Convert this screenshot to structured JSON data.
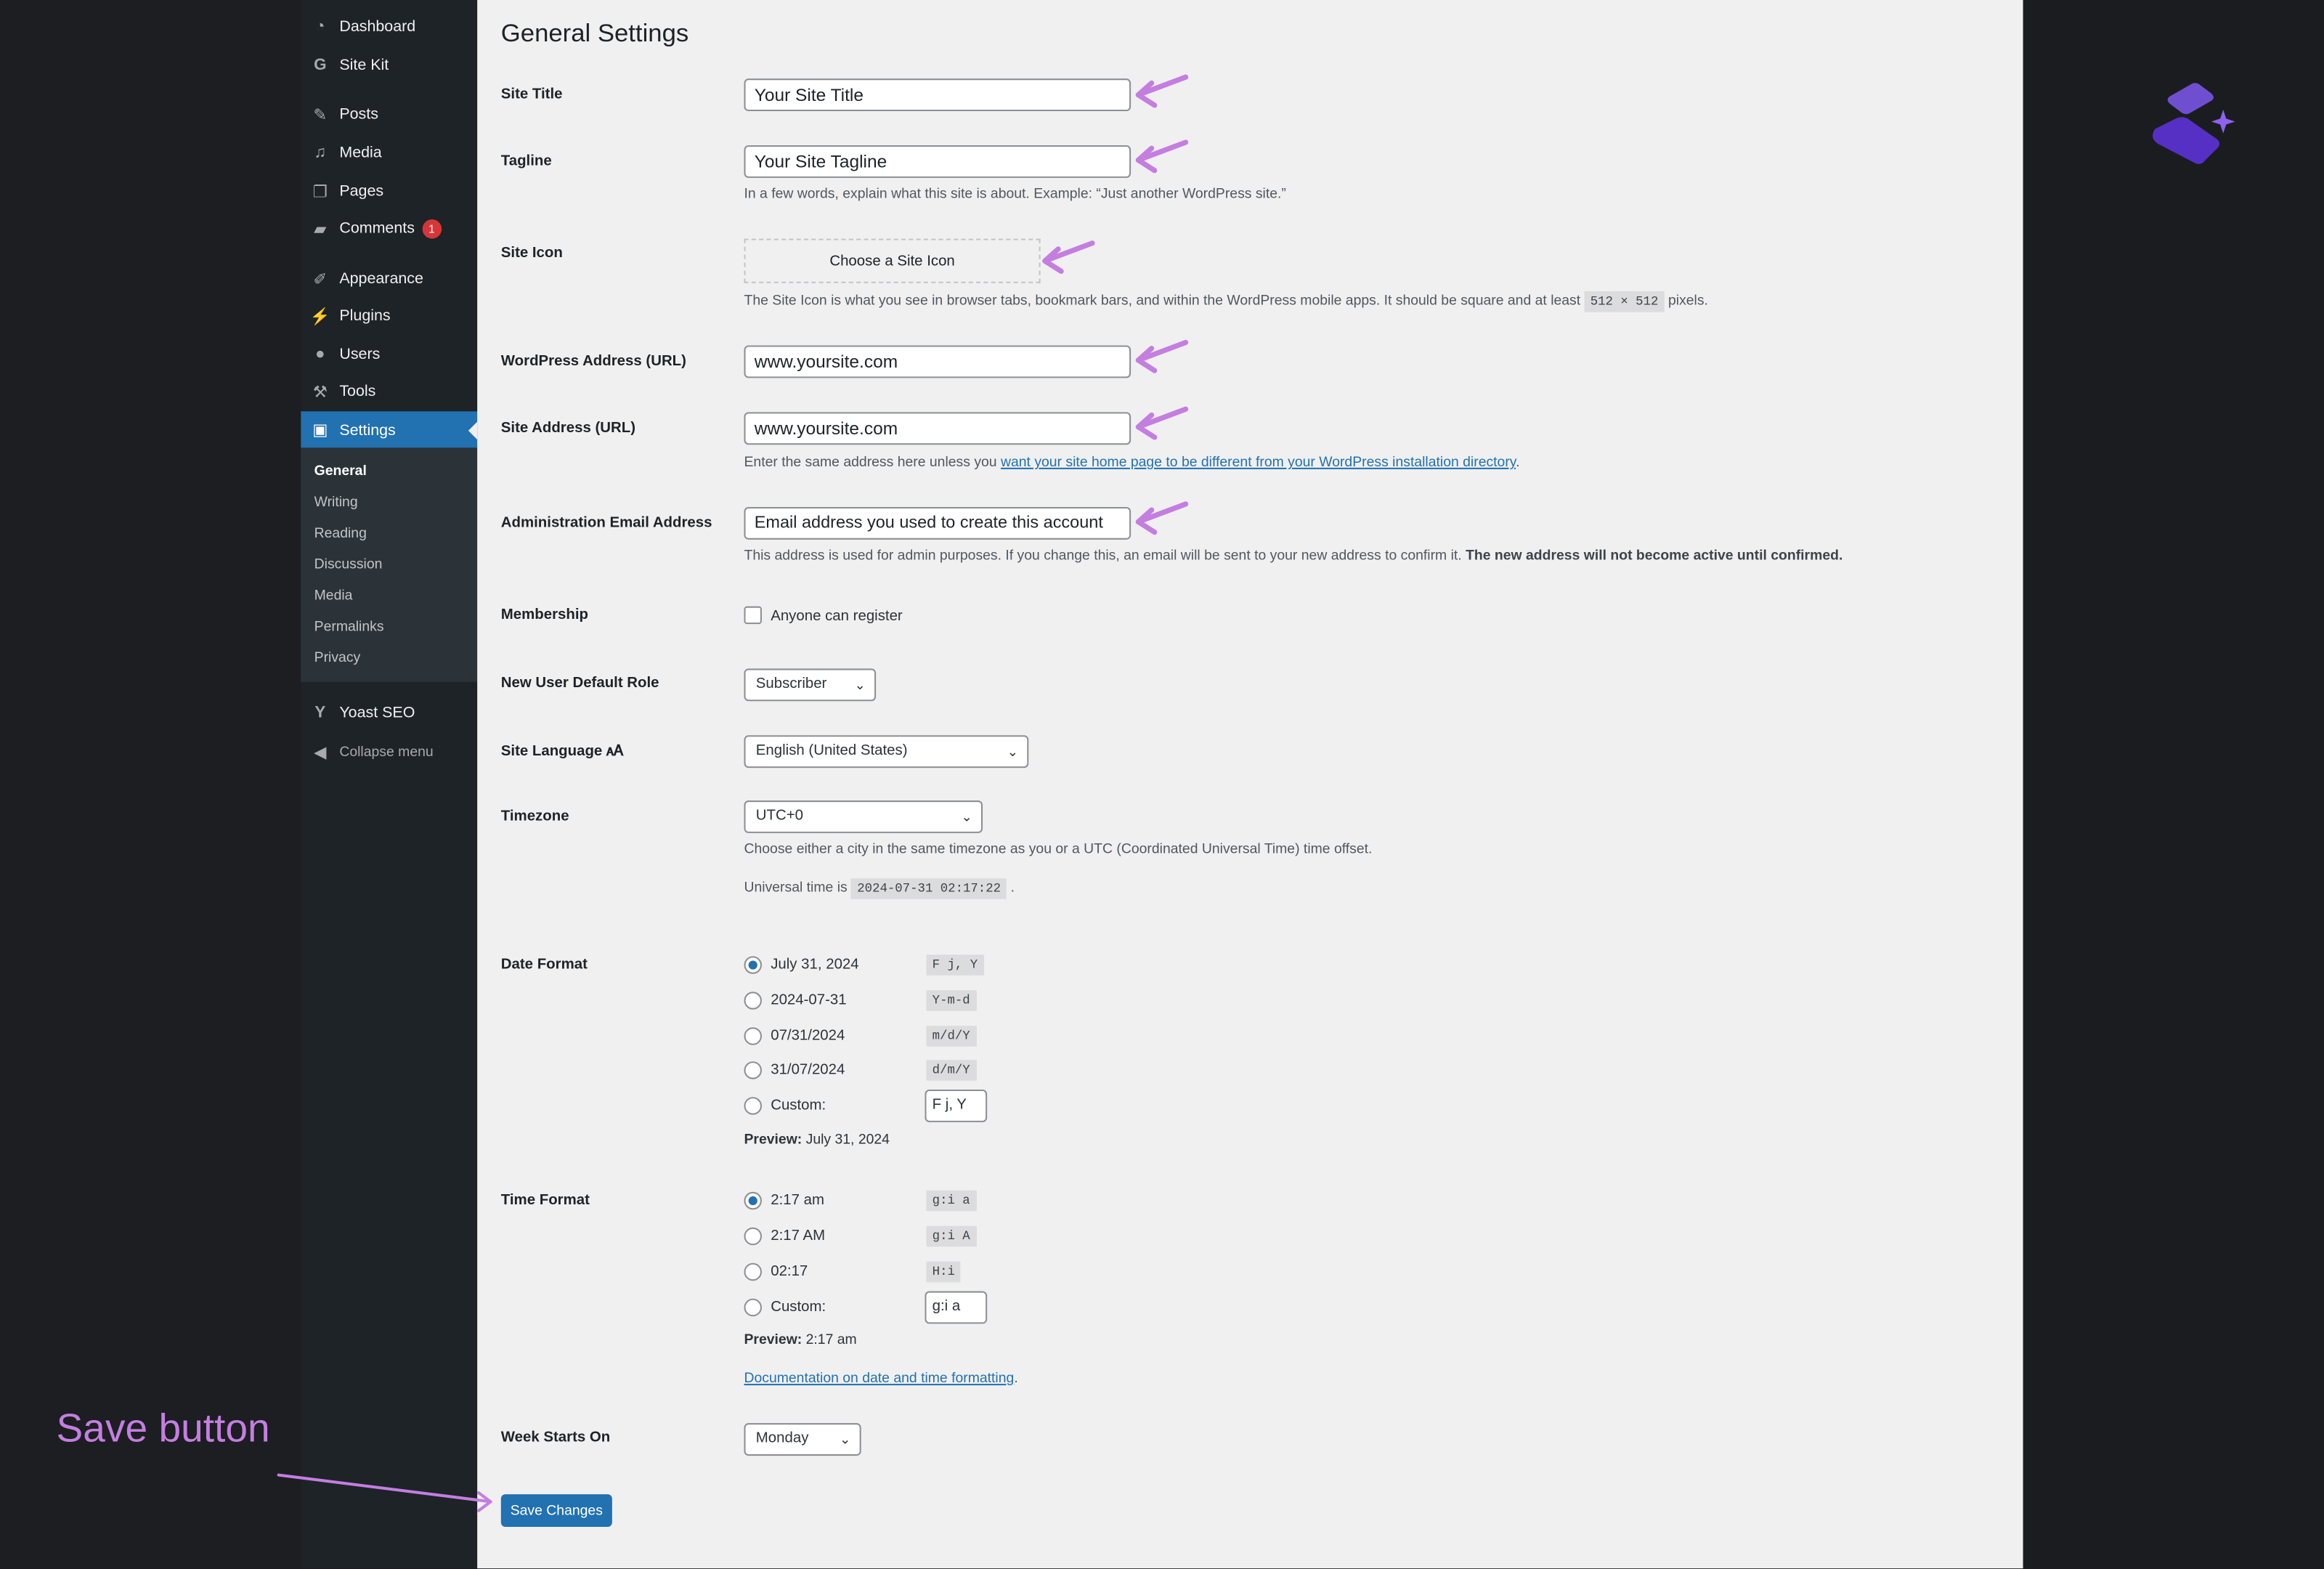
{
  "sidebar": {
    "items": [
      {
        "label": "Dashboard",
        "icon": "dashboard-icon"
      },
      {
        "label": "Site Kit",
        "icon": "google-g-icon"
      },
      {
        "label": "Posts",
        "icon": "pin-icon"
      },
      {
        "label": "Media",
        "icon": "media-icon"
      },
      {
        "label": "Pages",
        "icon": "pages-icon"
      },
      {
        "label": "Comments",
        "icon": "comment-icon",
        "badge": "1"
      },
      {
        "label": "Appearance",
        "icon": "brush-icon"
      },
      {
        "label": "Plugins",
        "icon": "plug-icon"
      },
      {
        "label": "Users",
        "icon": "user-icon"
      },
      {
        "label": "Tools",
        "icon": "wrench-icon"
      },
      {
        "label": "Settings",
        "icon": "settings-icon",
        "active": true
      }
    ],
    "submenu": [
      "General",
      "Writing",
      "Reading",
      "Discussion",
      "Media",
      "Permalinks",
      "Privacy"
    ],
    "yoast": "Yoast SEO",
    "collapse": "Collapse menu"
  },
  "page": {
    "title": "General Settings",
    "site_title": {
      "label": "Site Title",
      "value": "Your Site Title"
    },
    "tagline": {
      "label": "Tagline",
      "value": "Your Site Tagline",
      "desc": "In a few words, explain what this site is about. Example: “Just another WordPress site.”"
    },
    "site_icon": {
      "label": "Site Icon",
      "button": "Choose a Site Icon",
      "desc_pre": "The Site Icon is what you see in browser tabs, bookmark bars, and within the WordPress mobile apps. It should be square and at least",
      "desc_code": "512 × 512",
      "desc_post": "pixels."
    },
    "wp_address": {
      "label": "WordPress Address (URL)",
      "value": "www.yoursite.com"
    },
    "site_address": {
      "label": "Site Address (URL)",
      "value": "www.yoursite.com",
      "desc_pre": "Enter the same address here unless you",
      "desc_link": "want your site home page to be different from your WordPress installation directory",
      "desc_post": "."
    },
    "admin_email": {
      "label": "Administration Email Address",
      "value": "Email address you used to create this account",
      "desc_pre": "This address is used for admin purposes. If you change this, an email will be sent to your new address to confirm it.",
      "desc_bold": "The new address will not become active until confirmed."
    },
    "membership": {
      "label": "Membership",
      "checkbox": "Anyone can register",
      "checked": false
    },
    "default_role": {
      "label": "New User Default Role",
      "value": "Subscriber"
    },
    "language": {
      "label": "Site Language",
      "value": "English (United States)"
    },
    "timezone": {
      "label": "Timezone",
      "value": "UTC+0",
      "desc": "Choose either a city in the same timezone as you or a UTC (Coordinated Universal Time) time offset.",
      "universal_pre": "Universal time is",
      "universal_code": "2024-07-31 02:17:22",
      "universal_post": "."
    },
    "date_format": {
      "label": "Date Format",
      "options": [
        {
          "label": "July 31, 2024",
          "code": "F j, Y",
          "checked": true
        },
        {
          "label": "2024-07-31",
          "code": "Y-m-d"
        },
        {
          "label": "07/31/2024",
          "code": "m/d/Y"
        },
        {
          "label": "31/07/2024",
          "code": "d/m/Y"
        }
      ],
      "custom_label": "Custom:",
      "custom_value": "F j, Y",
      "preview_label": "Preview:",
      "preview_value": "July 31, 2024"
    },
    "time_format": {
      "label": "Time Format",
      "options": [
        {
          "label": "2:17 am",
          "code": "g:i a",
          "checked": true
        },
        {
          "label": "2:17 AM",
          "code": "g:i A"
        },
        {
          "label": "02:17",
          "code": "H:i"
        }
      ],
      "custom_label": "Custom:",
      "custom_value": "g:i a",
      "preview_label": "Preview:",
      "preview_value": "2:17 am",
      "doc_link": "Documentation on date and time formatting",
      "doc_post": "."
    },
    "week_start": {
      "label": "Week Starts On",
      "value": "Monday"
    },
    "save": "Save Changes"
  },
  "annotation": {
    "text": "Save button",
    "color": "#c47ee0"
  },
  "colors": {
    "accent": "#2271b1",
    "sidebar": "#1d2327",
    "arrow": "#c47ee0",
    "logo": "#6b46d6"
  }
}
